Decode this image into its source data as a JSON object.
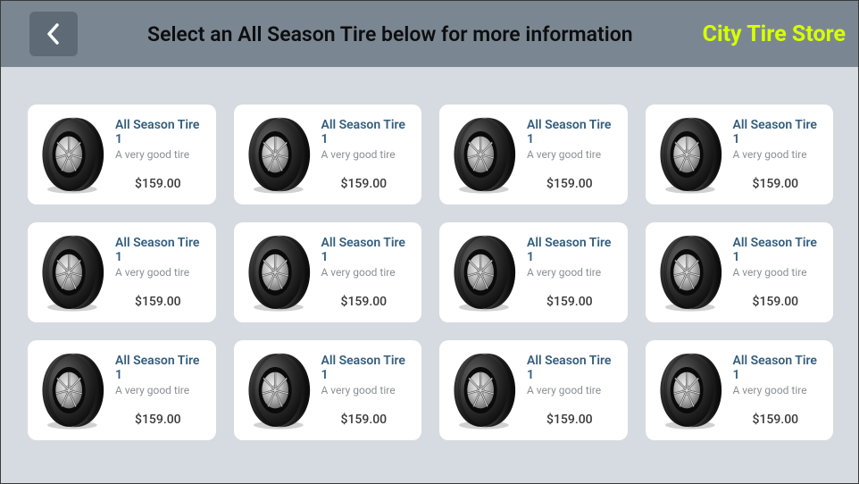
{
  "header": {
    "title": "Select an All Season Tire below for more information",
    "store_name": "City Tire Store"
  },
  "products": [
    {
      "title": "All Season Tire 1",
      "desc": "A very good tire",
      "price": "$159.00"
    },
    {
      "title": "All Season Tire 1",
      "desc": "A very good tire",
      "price": "$159.00"
    },
    {
      "title": "All Season Tire 1",
      "desc": "A very good tire",
      "price": "$159.00"
    },
    {
      "title": "All Season Tire 1",
      "desc": "A very good tire",
      "price": "$159.00"
    },
    {
      "title": "All Season Tire 1",
      "desc": "A very good tire",
      "price": "$159.00"
    },
    {
      "title": "All Season Tire 1",
      "desc": "A very good tire",
      "price": "$159.00"
    },
    {
      "title": "All Season Tire 1",
      "desc": "A very good tire",
      "price": "$159.00"
    },
    {
      "title": "All Season Tire 1",
      "desc": "A very good tire",
      "price": "$159.00"
    },
    {
      "title": "All Season Tire 1",
      "desc": "A very good tire",
      "price": "$159.00"
    },
    {
      "title": "All Season Tire 1",
      "desc": "A very good tire",
      "price": "$159.00"
    },
    {
      "title": "All Season Tire 1",
      "desc": "A very good tire",
      "price": "$159.00"
    },
    {
      "title": "All Season Tire 1",
      "desc": "A very good tire",
      "price": "$159.00"
    }
  ]
}
